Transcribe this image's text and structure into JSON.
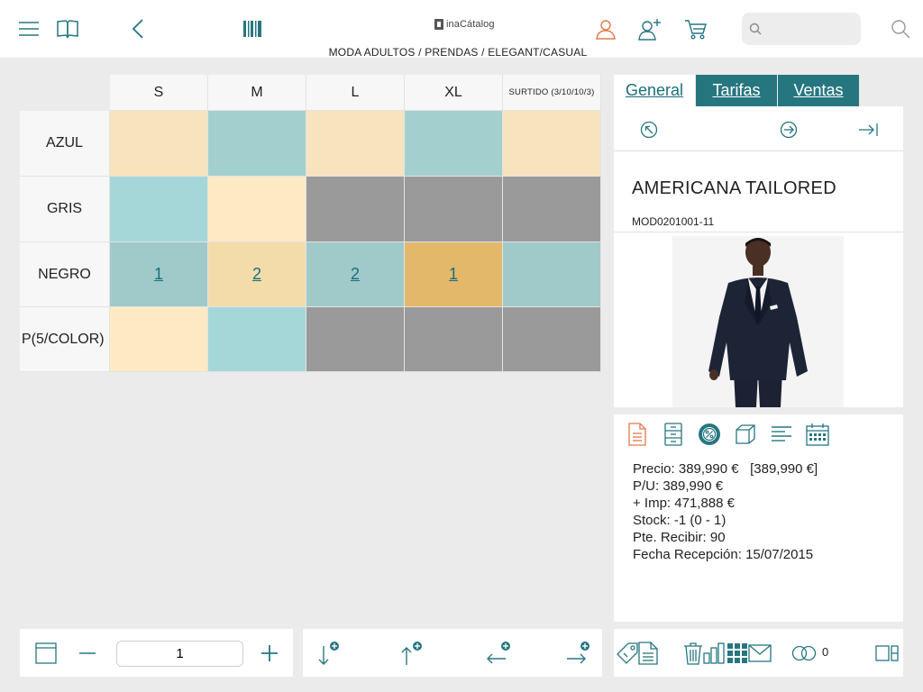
{
  "header": {
    "brand_name": "inaCátalog",
    "breadcrumb": "MODA ADULTOS / PRENDAS / ELEGANT/CASUAL",
    "search_placeholder": "",
    "icons": [
      "menu-icon",
      "book-icon",
      "back-icon",
      "barcode-icon",
      "user-icon",
      "add-user-icon",
      "cart-icon",
      "search-icon"
    ]
  },
  "grid": {
    "columns": [
      "S",
      "M",
      "L",
      "XL",
      "SURTIDO (3/10/10/3)"
    ],
    "rows": [
      {
        "label": "AZUL",
        "cells": [
          "",
          "",
          "",
          "",
          ""
        ]
      },
      {
        "label": "GRIS",
        "cells": [
          "",
          "",
          "",
          "",
          ""
        ]
      },
      {
        "label": "NEGRO",
        "cells": [
          "1",
          "2",
          "2",
          "1",
          ""
        ]
      },
      {
        "label": "P(5/COLOR)",
        "cells": [
          "",
          "",
          "",
          "",
          ""
        ]
      }
    ]
  },
  "tabs": {
    "general": "General",
    "tarifas": "Tarifas",
    "ventas": "Ventas"
  },
  "product": {
    "name": "AMERICANA TAILORED",
    "code": "MOD0201001-11"
  },
  "info": {
    "precio": "Precio: 389,990 €   [389,990 €]",
    "pu": "P/U: 389,990 €",
    "imp": "+ Imp: 471,888 €",
    "stock": "Stock: -1 (0 - 1)",
    "pte": "Pte. Recibir: 90",
    "fecha": "Fecha Recepción: 15/07/2015"
  },
  "toolbar": {
    "quantity": "1",
    "compare_count": "0"
  },
  "colors": {
    "accent": "#267680",
    "link": "#1b6e7a",
    "orange": "#e07a4a",
    "tan": "#f7e3bd",
    "teal": "#a3d0cf",
    "gray": "#9a9a9a",
    "gold": "#e3b86b"
  }
}
